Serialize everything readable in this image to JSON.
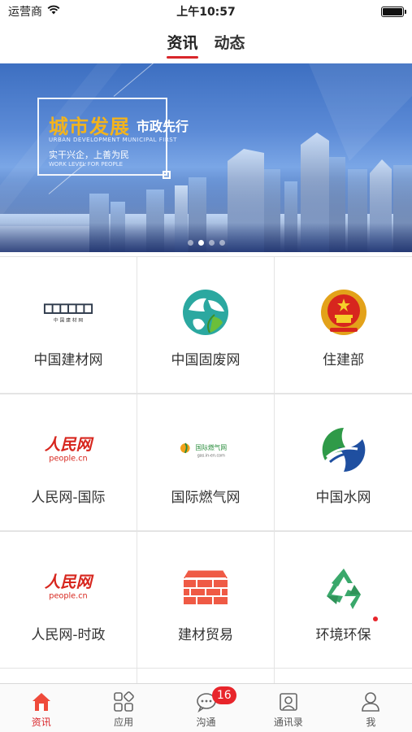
{
  "status_bar": {
    "carrier": "运营商",
    "time": "上午10:57",
    "wifi_icon": "wifi-icon",
    "battery_level": 1.0
  },
  "top_tabs": [
    {
      "label": "资讯",
      "active": true
    },
    {
      "label": "动态",
      "active": false
    }
  ],
  "banner": {
    "title_main": "城市发展",
    "title_side": "市政先行",
    "subtitle_en": "URBAN DEVELOPMENT  MUNICIPAL FIRST",
    "subtitle_cn": "实干兴企，上善为民",
    "subtitle_en2": "WORK LEVEL FOR PEOPLE",
    "page_count": 4,
    "active_page": 1
  },
  "grid": [
    {
      "label": "中国建材网",
      "logo": "cbmw-logo",
      "logo_text": "中 国 建 材 网",
      "dot": false
    },
    {
      "label": "中国固废网",
      "logo": "solidwaste-globe-logo",
      "dot": false
    },
    {
      "label": "住建部",
      "logo": "national-emblem-logo",
      "dot": false
    },
    {
      "label": "人民网-国际",
      "logo": "people-cn-logo",
      "logo_text": "人民网",
      "logo_sub": "people.cn",
      "dot": false
    },
    {
      "label": "国际燃气网",
      "logo": "gas-network-logo",
      "logo_text": "国际燃气网",
      "logo_sub": "gas.in-en.com",
      "dot": false
    },
    {
      "label": "中国水网",
      "logo": "water-network-logo",
      "dot": false
    },
    {
      "label": "人民网-时政",
      "logo": "people-cn-logo",
      "logo_text": "人民网",
      "logo_sub": "people.cn",
      "dot": false
    },
    {
      "label": "建材贸易",
      "logo": "bricks-logo",
      "dot": false
    },
    {
      "label": "环境环保",
      "logo": "recycle-logo",
      "dot": true
    }
  ],
  "tab_bar": [
    {
      "label": "资讯",
      "icon": "home-icon",
      "active": true
    },
    {
      "label": "应用",
      "icon": "apps-icon",
      "active": false
    },
    {
      "label": "沟通",
      "icon": "chat-icon",
      "active": false,
      "badge": "16"
    },
    {
      "label": "通讯录",
      "icon": "contacts-icon",
      "active": false
    },
    {
      "label": "我",
      "icon": "user-icon",
      "active": false
    }
  ],
  "colors": {
    "accent": "#d9262b",
    "badge": "#e8252b",
    "banner_title": "#f2b31d"
  }
}
